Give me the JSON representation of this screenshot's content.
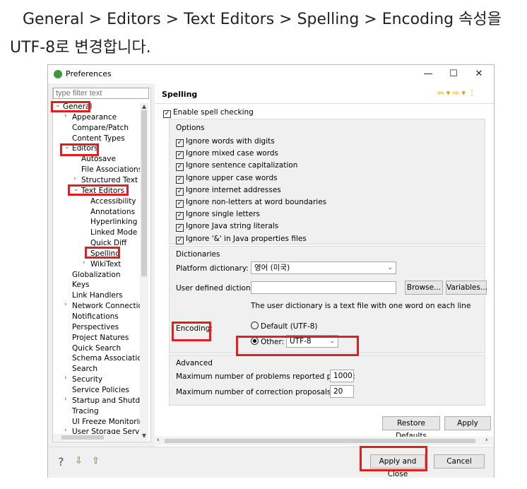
{
  "caption": {
    "line1": "General > Editors > Text Editors > Spelling > Encoding 속성을",
    "line2": "UTF-8로 변경합니다."
  },
  "window": {
    "title": "Preferences",
    "controls": {
      "min": "—",
      "max": "☐",
      "close": "✕"
    }
  },
  "filter": {
    "placeholder": "type filter text"
  },
  "tree": [
    {
      "label": "General",
      "arrow": "⌄",
      "level": 0
    },
    {
      "label": "Appearance",
      "arrow": "›",
      "level": 1
    },
    {
      "label": "Compare/Patch",
      "arrow": "",
      "level": 1
    },
    {
      "label": "Content Types",
      "arrow": "",
      "level": 1
    },
    {
      "label": "Editors",
      "arrow": "⌄",
      "level": 1
    },
    {
      "label": "Autosave",
      "arrow": "",
      "level": 2
    },
    {
      "label": "File Associations",
      "arrow": "",
      "level": 2
    },
    {
      "label": "Structured Text Ec",
      "arrow": "›",
      "level": 2
    },
    {
      "label": "Text Editors",
      "arrow": "⌄",
      "level": 2
    },
    {
      "label": "Accessibility",
      "arrow": "",
      "level": 3
    },
    {
      "label": "Annotations",
      "arrow": "",
      "level": 3
    },
    {
      "label": "Hyperlinking",
      "arrow": "",
      "level": 3
    },
    {
      "label": "Linked Mode",
      "arrow": "",
      "level": 3
    },
    {
      "label": "Quick Diff",
      "arrow": "",
      "level": 3
    },
    {
      "label": "Spelling",
      "arrow": "",
      "level": 3
    },
    {
      "label": "WikiText",
      "arrow": "›",
      "level": 3
    },
    {
      "label": "Globalization",
      "arrow": "",
      "level": 1
    },
    {
      "label": "Keys",
      "arrow": "",
      "level": 1
    },
    {
      "label": "Link Handlers",
      "arrow": "",
      "level": 1
    },
    {
      "label": "Network Connection",
      "arrow": "›",
      "level": 1
    },
    {
      "label": "Notifications",
      "arrow": "",
      "level": 1
    },
    {
      "label": "Perspectives",
      "arrow": "",
      "level": 1
    },
    {
      "label": "Project Natures",
      "arrow": "",
      "level": 1
    },
    {
      "label": "Quick Search",
      "arrow": "",
      "level": 1
    },
    {
      "label": "Schema Associations",
      "arrow": "",
      "level": 1
    },
    {
      "label": "Search",
      "arrow": "",
      "level": 1
    },
    {
      "label": "Security",
      "arrow": "›",
      "level": 1
    },
    {
      "label": "Service Policies",
      "arrow": "",
      "level": 1
    },
    {
      "label": "Startup and Shutdov",
      "arrow": "›",
      "level": 1
    },
    {
      "label": "Tracing",
      "arrow": "",
      "level": 1
    },
    {
      "label": "UI Freeze Monitoring",
      "arrow": "",
      "level": 1
    },
    {
      "label": "User Storage Service",
      "arrow": "›",
      "level": 1
    }
  ],
  "page": {
    "title": "Spelling",
    "enable_label": "Enable spell checking",
    "options_title": "Options",
    "options": [
      "Ignore words with digits",
      "Ignore mixed case words",
      "Ignore sentence capitalization",
      "Ignore upper case words",
      "Ignore internet addresses",
      "Ignore non-letters at word boundaries",
      "Ignore single letters",
      "Ignore Java string literals",
      "Ignore '&' in Java properties files"
    ],
    "dict_title": "Dictionaries",
    "platform_label": "Platform dictionary:",
    "platform_value": "영어 (미국)",
    "user_dict_label": "User defined dictionary:",
    "user_dict_value": "",
    "browse": "Browse...",
    "variables": "Variables...",
    "dict_note": "The user dictionary is a text file with one word on each line",
    "encoding_label": "Encoding:",
    "default_enc": "Default (UTF-8)",
    "other_label": "Other:",
    "other_value": "UTF-8",
    "adv_title": "Advanced",
    "max_problems_label": "Maximum number of problems reported per file:",
    "max_problems_value": "1000",
    "max_corrections_label": "Maximum number of correction proposals:",
    "max_corrections_value": "20",
    "restore_defaults": "Restore Defaults",
    "apply": "Apply"
  },
  "footer": {
    "apply_close": "Apply and Close",
    "cancel": "Cancel"
  },
  "colors": {
    "highlight": "#e02020"
  }
}
